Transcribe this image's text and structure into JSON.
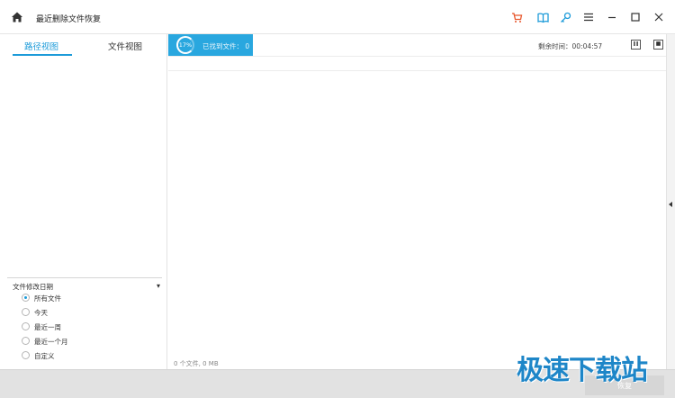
{
  "app": {
    "title": "最近删除文件恢复"
  },
  "toolbar": {
    "icons": [
      "home-icon",
      "cart-icon",
      "book-icon",
      "key-icon",
      "menu-icon",
      "minimize-icon",
      "maximize-icon",
      "close-icon"
    ],
    "cart_color": "#e8572c",
    "accent_color": "#1d9bd9"
  },
  "sidebar": {
    "tabs": [
      {
        "label": "路径视图",
        "active": true
      },
      {
        "label": "文件视图",
        "active": false
      }
    ],
    "filter": {
      "title": "文件修改日期",
      "options": [
        {
          "label": "所有文件",
          "checked": true
        },
        {
          "label": "今天",
          "checked": false
        },
        {
          "label": "最近一周",
          "checked": false
        },
        {
          "label": "最近一个月",
          "checked": false
        },
        {
          "label": "自定义",
          "checked": false
        }
      ]
    }
  },
  "scan": {
    "progress_label": "17%",
    "progress": 0.17,
    "found_text": "已找到文件：  0",
    "time_remaining": "剩余时间：00:04:57"
  },
  "status": {
    "summary": "0 个文件, 0 MB"
  },
  "footer": {
    "recover_label": "恢复"
  },
  "watermark": {
    "text": "极速下载站"
  }
}
